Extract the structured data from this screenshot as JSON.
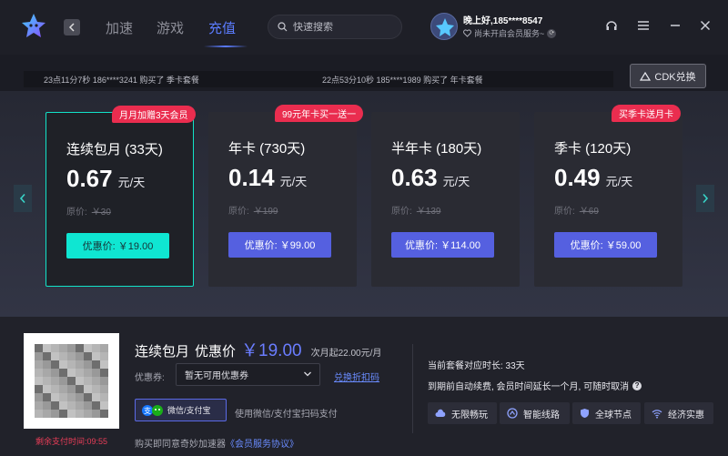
{
  "nav": {
    "tabs": [
      {
        "label": "加速"
      },
      {
        "label": "游戏"
      },
      {
        "label": "充值"
      }
    ],
    "active_tab": "充值"
  },
  "search": {
    "placeholder": "快速搜索"
  },
  "user": {
    "greeting": "晚上好,185****8547",
    "vip_status": "尚未开启会员服务~"
  },
  "ticker": {
    "items": [
      "23点11分7秒  186****3241  购买了  季卡套餐",
      "22点53分10秒  185****1989  购买了  年卡套餐"
    ]
  },
  "cdk_button": {
    "label": "CDK兑换"
  },
  "plans": [
    {
      "badge": "月月加赠3天会员",
      "name": "连续包月 (33天)",
      "price": "0.67",
      "unit": "元/天",
      "orig_label": "原价:",
      "orig_price": "￥30",
      "deal": "优惠价: ￥19.00",
      "selected": true
    },
    {
      "badge": "99元年卡买一送一",
      "name": "年卡 (730天)",
      "price": "0.14",
      "unit": "元/天",
      "orig_label": "原价:",
      "orig_price": "￥199",
      "deal": "优惠价: ￥99.00",
      "selected": false
    },
    {
      "badge": "",
      "name": "半年卡 (180天)",
      "price": "0.63",
      "unit": "元/天",
      "orig_label": "原价:",
      "orig_price": "￥139",
      "deal": "优惠价: ￥114.00",
      "selected": false
    },
    {
      "badge": "买季卡送月卡",
      "name": "季卡 (120天)",
      "price": "0.49",
      "unit": "元/天",
      "orig_label": "原价:",
      "orig_price": "￥69",
      "deal": "优惠价: ￥59.00",
      "selected": false
    }
  ],
  "payment": {
    "selected_plan": "连续包月",
    "price_label": "优惠价",
    "price": "￥19.00",
    "next_month": "次月起22.00元/月",
    "coupon_label": "优惠券:",
    "coupon_value": "暂无可用优惠券",
    "redeem_link": "兑换折扣码",
    "method_label": "微信/支付宝",
    "pay_hint": "使用微信/支付宝扫码支付",
    "agree_prefix": "购买即同意奇妙加速器",
    "agree_link": "《会员服务协议》",
    "timer_label": "剩余支付时间:",
    "timer_value": "09:55",
    "duration_info": "当前套餐对应时长: 33天",
    "renew_info": "到期前自动续费, 会员时间延长一个月, 可随时取消"
  },
  "features": [
    {
      "label": "无限畅玩",
      "icon": "cloud-icon"
    },
    {
      "label": "智能线路",
      "icon": "route-icon"
    },
    {
      "label": "全球节点",
      "icon": "shield-icon"
    },
    {
      "label": "经济实惠",
      "icon": "wifi-icon"
    }
  ],
  "colors": {
    "accent": "#5b7cff",
    "selected_border": "#12e3c8",
    "badge": "#ea2d4f",
    "deal_button": "#5560e0",
    "selected_deal_button": "#0fe6d2"
  }
}
